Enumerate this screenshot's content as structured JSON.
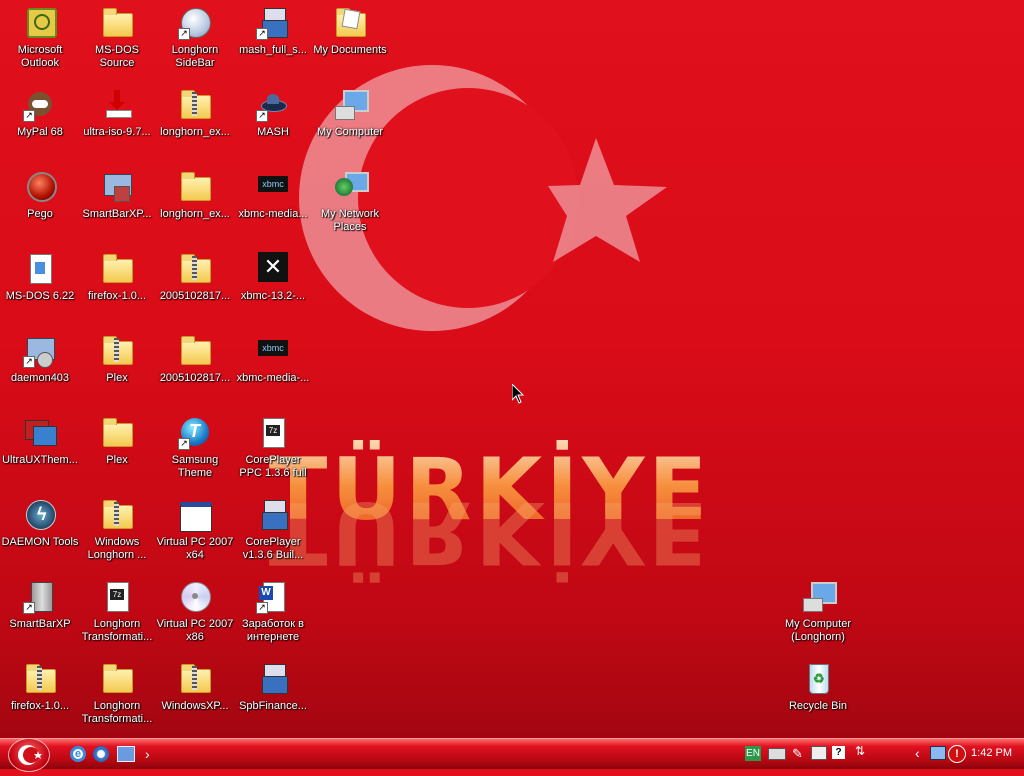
{
  "wallpaper": {
    "text": "TÜRKİYE",
    "colors": {
      "flag_red": "#e0101c",
      "crescent": "#f0a0a6"
    }
  },
  "desktop": {
    "icons": [
      {
        "label": "Microsoft\nOutlook",
        "icon": "outlook-icon"
      },
      {
        "label": "MS-DOS\nSource",
        "icon": "folder-icon"
      },
      {
        "label": "Longhorn\nSideBar",
        "icon": "sidebar-icon"
      },
      {
        "label": "mash_full_s...",
        "icon": "installer-icon"
      },
      {
        "label": "My Documents",
        "icon": "my-documents-icon"
      },
      {
        "label": "MyPal 68",
        "icon": "mypal-icon"
      },
      {
        "label": "ultra-iso-9.7...",
        "icon": "download-icon"
      },
      {
        "label": "longhorn_ex...",
        "icon": "zip-folder-icon"
      },
      {
        "label": "MASH",
        "icon": "mash-icon"
      },
      {
        "label": "My Computer",
        "icon": "computer-icon"
      },
      {
        "label": "Pego",
        "icon": "pego-icon"
      },
      {
        "label": "SmartBarXP...",
        "icon": "setup-icon"
      },
      {
        "label": "longhorn_ex...",
        "icon": "folder-icon"
      },
      {
        "label": "xbmc-media...",
        "icon": "xbmc-icon"
      },
      {
        "label": "My Network\nPlaces",
        "icon": "network-icon"
      },
      {
        "label": "MS-DOS 6.22",
        "icon": "document-icon"
      },
      {
        "label": "firefox-1.0...",
        "icon": "folder-icon"
      },
      {
        "label": "2005102817...",
        "icon": "zip-folder-icon"
      },
      {
        "label": "xbmc-13.2-...",
        "icon": "xbmc-x-icon"
      },
      {
        "label": "daemon403",
        "icon": "setup-icon"
      },
      {
        "label": "Plex",
        "icon": "zip-folder-icon"
      },
      {
        "label": "2005102817...",
        "icon": "folder-icon"
      },
      {
        "label": "xbmc-media-...",
        "icon": "xbmc-icon"
      },
      {
        "label": "UltraUXThem...",
        "icon": "theme-icon"
      },
      {
        "label": "Plex",
        "icon": "folder-icon"
      },
      {
        "label": "Samsung\nTheme",
        "icon": "samsung-theme-icon"
      },
      {
        "label": "CorePlayer\nPPC 1.3.6 full",
        "icon": "7z-icon"
      },
      {
        "label": "DAEMON Tools",
        "icon": "daemon-tools-icon"
      },
      {
        "label": "Windows\nLonghorn ...",
        "icon": "zip-folder-icon"
      },
      {
        "label": "Virtual PC 2007\nx64",
        "icon": "window-icon"
      },
      {
        "label": "CorePlayer\nv1.3.6 Buil...",
        "icon": "installer-icon"
      },
      {
        "label": "SmartBarXP",
        "icon": "smartbar-icon"
      },
      {
        "label": "Longhorn\nTransformati...",
        "icon": "7z-icon"
      },
      {
        "label": "Virtual PC 2007\nx86",
        "icon": "cd-icon"
      },
      {
        "label": "Заработок в\nинтернете",
        "icon": "word-doc-icon"
      },
      {
        "label": "My Computer\n(Longhorn)",
        "icon": "computer-icon"
      },
      {
        "label": "firefox-1.0...",
        "icon": "zip-folder-icon"
      },
      {
        "label": "Longhorn\nTransformati...",
        "icon": "folder-icon"
      },
      {
        "label": "WindowsXP...",
        "icon": "zip-folder-icon"
      },
      {
        "label": "SpbFinance...",
        "icon": "installer-icon"
      },
      {
        "label": "Recycle Bin",
        "icon": "recycle-bin-icon"
      }
    ]
  },
  "taskbar": {
    "start_icon": "crescent-start-icon",
    "quick_launch": [
      "internet-explorer-icon",
      "windows-explorer-icon",
      "show-desktop-icon"
    ],
    "chevron": "›",
    "tray": {
      "language": "EN",
      "show_hidden": "‹",
      "clock": "1:42 PM"
    }
  }
}
